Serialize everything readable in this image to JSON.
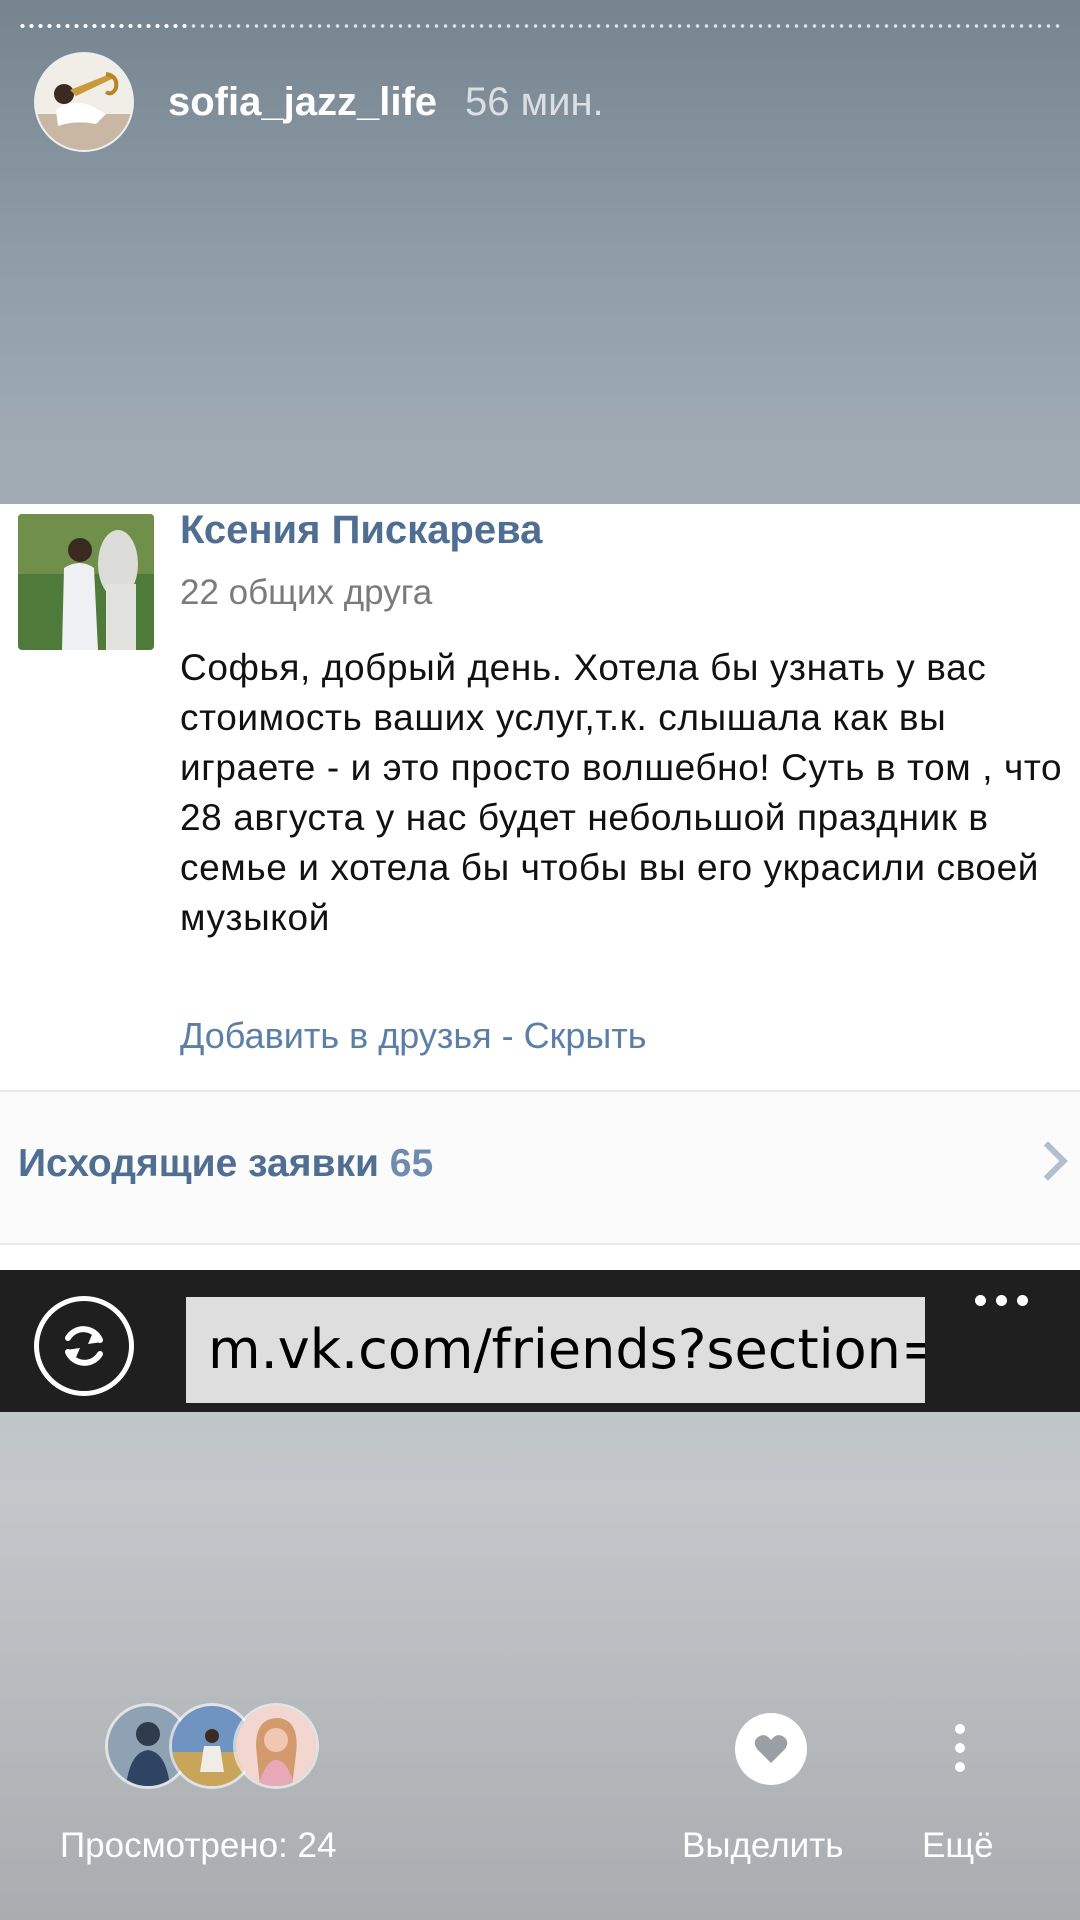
{
  "story": {
    "username": "sofia_jazz_life",
    "time_ago": "56 мин."
  },
  "screenshot": {
    "friend_request": {
      "name": "Ксения Пискарева",
      "mutual_friends": "22 общих друга",
      "message": "Софья, добрый день. Хотела бы узнать у вас стоимость ваших услуг,т.к. слышала как вы играете - и это просто волшебно! Суть в том , что 28 августа у нас будет небольшой праздник в семье и хотела бы чтобы вы его украсили своей музыкой",
      "add_friend_label": "Добавить в друзья",
      "separator": " - ",
      "hide_label": "Скрыть"
    },
    "outgoing_requests": {
      "label": "Исходящие заявки",
      "count": "65"
    },
    "browser": {
      "url": "m.vk.com/friends?section=re"
    }
  },
  "footer": {
    "viewed_label": "Просмотрено: 24",
    "highlight_label": "Выделить",
    "more_label": "Ещё"
  },
  "icons": [
    "refresh-icon",
    "more-horizontal-icon",
    "heart-icon",
    "more-vertical-icon",
    "chevron-right-icon"
  ]
}
